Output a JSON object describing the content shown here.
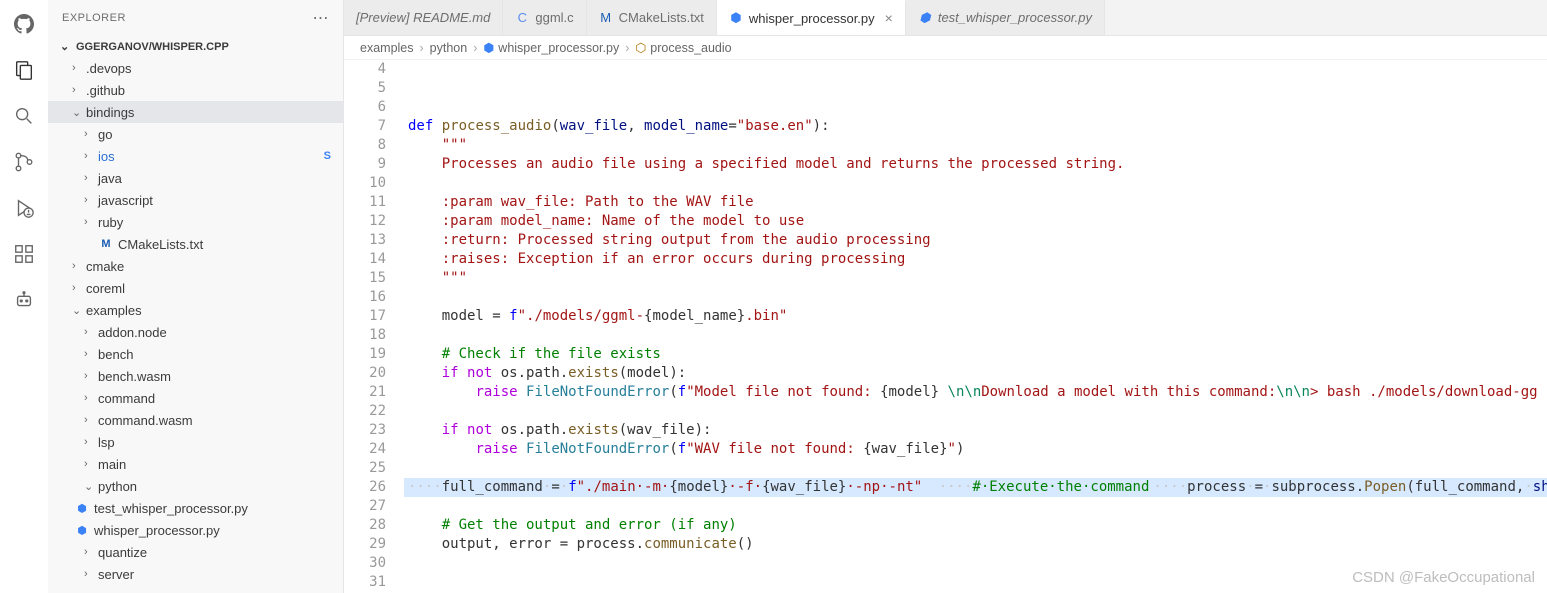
{
  "sidebar": {
    "explorer_label": "EXPLORER",
    "project_name": "GGERGANOV/WHISPER.CPP",
    "items": [
      {
        "label": ".devops",
        "type": "folder",
        "expanded": false,
        "indent": 1
      },
      {
        "label": ".github",
        "type": "folder",
        "expanded": false,
        "indent": 1
      },
      {
        "label": "bindings",
        "type": "folder",
        "expanded": true,
        "indent": 1,
        "selected": true
      },
      {
        "label": "go",
        "type": "folder",
        "expanded": false,
        "indent": 2
      },
      {
        "label": "ios",
        "type": "folder",
        "expanded": false,
        "indent": 2,
        "badge": "S",
        "ios": true
      },
      {
        "label": "java",
        "type": "folder",
        "expanded": false,
        "indent": 2
      },
      {
        "label": "javascript",
        "type": "folder",
        "expanded": false,
        "indent": 2
      },
      {
        "label": "ruby",
        "type": "folder",
        "expanded": false,
        "indent": 2
      },
      {
        "label": "CMakeLists.txt",
        "type": "file",
        "icon": "M",
        "iconClass": "file-icon-cmake",
        "indent": 2
      },
      {
        "label": "cmake",
        "type": "folder",
        "expanded": false,
        "indent": 1
      },
      {
        "label": "coreml",
        "type": "folder",
        "expanded": false,
        "indent": 1
      },
      {
        "label": "examples",
        "type": "folder",
        "expanded": true,
        "indent": 1
      },
      {
        "label": "addon.node",
        "type": "folder",
        "expanded": false,
        "indent": 2
      },
      {
        "label": "bench",
        "type": "folder",
        "expanded": false,
        "indent": 2
      },
      {
        "label": "bench.wasm",
        "type": "folder",
        "expanded": false,
        "indent": 2
      },
      {
        "label": "command",
        "type": "folder",
        "expanded": false,
        "indent": 2
      },
      {
        "label": "command.wasm",
        "type": "folder",
        "expanded": false,
        "indent": 2
      },
      {
        "label": "lsp",
        "type": "folder",
        "expanded": false,
        "indent": 2
      },
      {
        "label": "main",
        "type": "folder",
        "expanded": false,
        "indent": 2
      },
      {
        "label": "python",
        "type": "folder",
        "expanded": true,
        "indent": 2
      },
      {
        "label": "test_whisper_processor.py",
        "type": "file",
        "icon": "⬢",
        "iconClass": "file-icon-py",
        "indent": 3
      },
      {
        "label": "whisper_processor.py",
        "type": "file",
        "icon": "⬢",
        "iconClass": "file-icon-py",
        "indent": 3
      },
      {
        "label": "quantize",
        "type": "folder",
        "expanded": false,
        "indent": 2
      },
      {
        "label": "server",
        "type": "folder",
        "expanded": false,
        "indent": 2
      }
    ]
  },
  "tabs": [
    {
      "label": "[Preview] README.md",
      "icon": "",
      "style": "italic"
    },
    {
      "label": "ggml.c",
      "icon": "C",
      "iconColor": "#5b8def",
      "style": "normal"
    },
    {
      "label": "CMakeLists.txt",
      "icon": "M",
      "iconColor": "#1a5fb4",
      "style": "normal"
    },
    {
      "label": "whisper_processor.py",
      "icon": "⬢",
      "iconColor": "#3b82f6",
      "style": "normal",
      "active": true,
      "close": true
    },
    {
      "label": "test_whisper_processor.py",
      "icon": "⬢",
      "iconColor": "#3b82f6",
      "style": "italic"
    }
  ],
  "breadcrumb": {
    "parts": [
      "examples",
      "python",
      "whisper_processor.py",
      "process_audio"
    ],
    "file_icon": "⬢",
    "fn_icon": "⬡"
  },
  "code": {
    "first_line": 4,
    "lines": [
      {
        "n": 4,
        "html": ""
      },
      {
        "n": 5,
        "html": "<span class='k-def'>def</span> <span class='k-fn'>process_audio</span>(<span class='k-param'>wav_file</span>, <span class='k-param'>model_name</span>=<span class='k-str'>\"base.en\"</span>):"
      },
      {
        "n": 6,
        "html": "    <span class='k-str'>\"\"\"</span>",
        "guide": true
      },
      {
        "n": 7,
        "html": "    <span class='k-str'>Processes an audio file using a specified model and returns the processed string.</span>",
        "guide": true
      },
      {
        "n": 8,
        "html": "",
        "guide": true
      },
      {
        "n": 9,
        "html": "    <span class='k-str'>:param wav_file: Path to the WAV file</span>",
        "guide": true
      },
      {
        "n": 10,
        "html": "    <span class='k-str'>:param model_name: Name of the model to use</span>",
        "guide": true
      },
      {
        "n": 11,
        "html": "    <span class='k-str'>:return: Processed string output from the audio processing</span>",
        "guide": true
      },
      {
        "n": 12,
        "html": "    <span class='k-str'>:raises: Exception if an error occurs during processing</span>",
        "guide": true
      },
      {
        "n": 13,
        "html": "    <span class='k-str'>\"\"\"</span>",
        "guide": true
      },
      {
        "n": 14,
        "html": "",
        "guide": true
      },
      {
        "n": 15,
        "html": "    model = <span class='k-const'>f</span><span class='k-str'>\"./models/ggml-</span>{model_name}<span class='k-str'>.bin\"</span>",
        "guide": true
      },
      {
        "n": 16,
        "html": "",
        "guide": true
      },
      {
        "n": 17,
        "html": "    <span class='k-comment'># Check if the file exists</span>",
        "guide": true
      },
      {
        "n": 18,
        "html": "    <span class='k-kw'>if</span> <span class='k-kw'>not</span> os.path.<span class='k-fn'>exists</span>(model):",
        "guide": true
      },
      {
        "n": 19,
        "html": "        <span class='k-kw'>raise</span> <span class='k-type'>FileNotFoundError</span>(<span class='k-const'>f</span><span class='k-str'>\"Model file not found: </span>{model}<span class='k-str'> </span><span class='k-num'>\\n\\n</span><span class='k-str'>Download a model with this command:</span><span class='k-num'>\\n\\n</span><span class='k-str'>&gt; bash ./models/download-gg</span>",
        "guide": true
      },
      {
        "n": 20,
        "html": "",
        "guide": true
      },
      {
        "n": 21,
        "html": "    <span class='k-kw'>if</span> <span class='k-kw'>not</span> os.path.<span class='k-fn'>exists</span>(wav_file):",
        "guide": true
      },
      {
        "n": 22,
        "html": "        <span class='k-kw'>raise</span> <span class='k-type'>FileNotFoundError</span>(<span class='k-const'>f</span><span class='k-str'>\"WAV file not found: </span>{wav_file}<span class='k-str'>\"</span>)",
        "guide": true
      },
      {
        "n": 23,
        "html": "",
        "guide": true
      },
      {
        "n": 24,
        "html": "<span class='ws'>····</span>full_command<span class='ws'>·</span>=<span class='ws'>·</span><span class='k-const'>f</span><span class='k-str'>\"./main·-m·</span>{model}<span class='k-str'>·-f·</span>{wav_file}<span class='k-str'>·-np·-nt\"</span>",
        "guide": true,
        "sel": true
      },
      {
        "n": 25,
        "html": "",
        "guide": true,
        "sel": true
      },
      {
        "n": 26,
        "html": "<span class='ws'>····</span><span class='k-comment'>#·Execute·the·command</span>",
        "guide": true,
        "sel": true
      },
      {
        "n": 27,
        "html": "<span class='ws'>····</span>process<span class='ws'>·</span>=<span class='ws'>·</span>subprocess.<span class='k-fn'>Popen</span>(full_command,<span class='ws'>·</span><span class='k-param'>shell</span>=<span class='k-const'>True</span>,<span class='ws'>·</span><span class='k-param'>stdout</span>=subprocess.PIPE,<span class='ws'>·</span><span class='k-param'>stderr</span>=subprocess.PIPE)",
        "guide": true,
        "sel": true
      },
      {
        "n": 28,
        "html": "",
        "guide": true
      },
      {
        "n": 29,
        "html": "    <span class='k-comment'># Get the output and error (if any)</span>",
        "guide": true
      },
      {
        "n": 30,
        "html": "    output, error = process.<span class='k-fn'>communicate</span>()",
        "guide": true
      },
      {
        "n": 31,
        "html": "",
        "guide": true
      }
    ]
  },
  "watermark": "CSDN @FakeOccupational"
}
